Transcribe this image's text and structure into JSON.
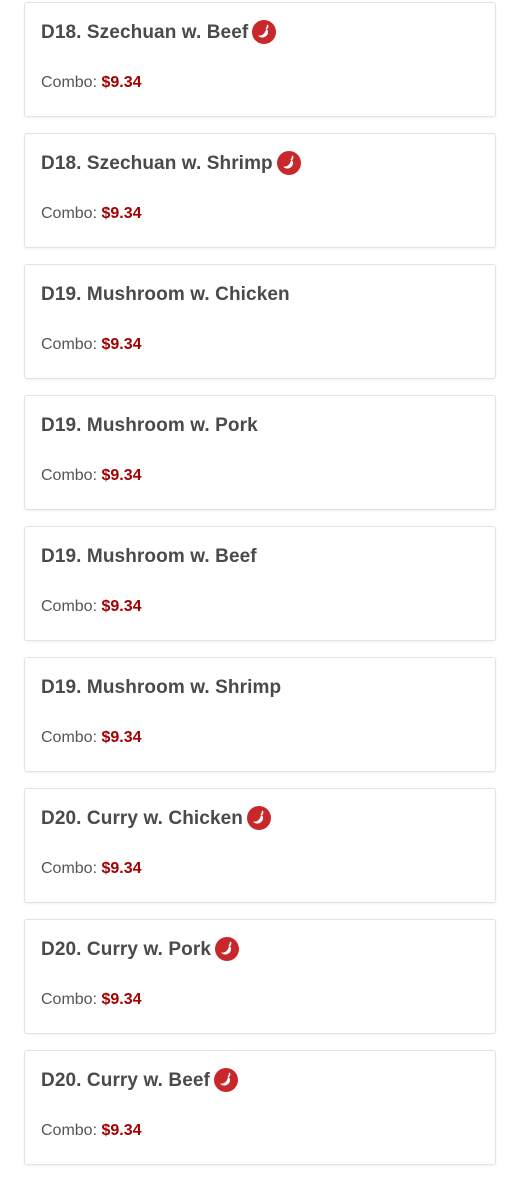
{
  "colors": {
    "price": "#a30000",
    "title": "#4a4a4a",
    "label": "#555555",
    "spicy_icon": "#c8272b",
    "card_border": "#e3e3e3"
  },
  "menu": {
    "items": [
      {
        "name": "D18. Szechuan w. Beef",
        "spicy": true,
        "combo_label": "Combo: ",
        "combo_price": "$9.34"
      },
      {
        "name": "D18. Szechuan w. Shrimp",
        "spicy": true,
        "combo_label": "Combo: ",
        "combo_price": "$9.34"
      },
      {
        "name": "D19. Mushroom w. Chicken",
        "spicy": false,
        "combo_label": "Combo: ",
        "combo_price": "$9.34"
      },
      {
        "name": "D19. Mushroom w. Pork",
        "spicy": false,
        "combo_label": "Combo: ",
        "combo_price": "$9.34"
      },
      {
        "name": "D19. Mushroom w. Beef",
        "spicy": false,
        "combo_label": "Combo: ",
        "combo_price": "$9.34"
      },
      {
        "name": "D19. Mushroom w. Shrimp",
        "spicy": false,
        "combo_label": "Combo: ",
        "combo_price": "$9.34"
      },
      {
        "name": "D20. Curry w. Chicken",
        "spicy": true,
        "combo_label": "Combo: ",
        "combo_price": "$9.34"
      },
      {
        "name": "D20. Curry w. Pork",
        "spicy": true,
        "combo_label": "Combo: ",
        "combo_price": "$9.34"
      },
      {
        "name": "D20. Curry w. Beef",
        "spicy": true,
        "combo_label": "Combo: ",
        "combo_price": "$9.34"
      }
    ],
    "spicy_icon_name": "chili-pepper-icon"
  }
}
